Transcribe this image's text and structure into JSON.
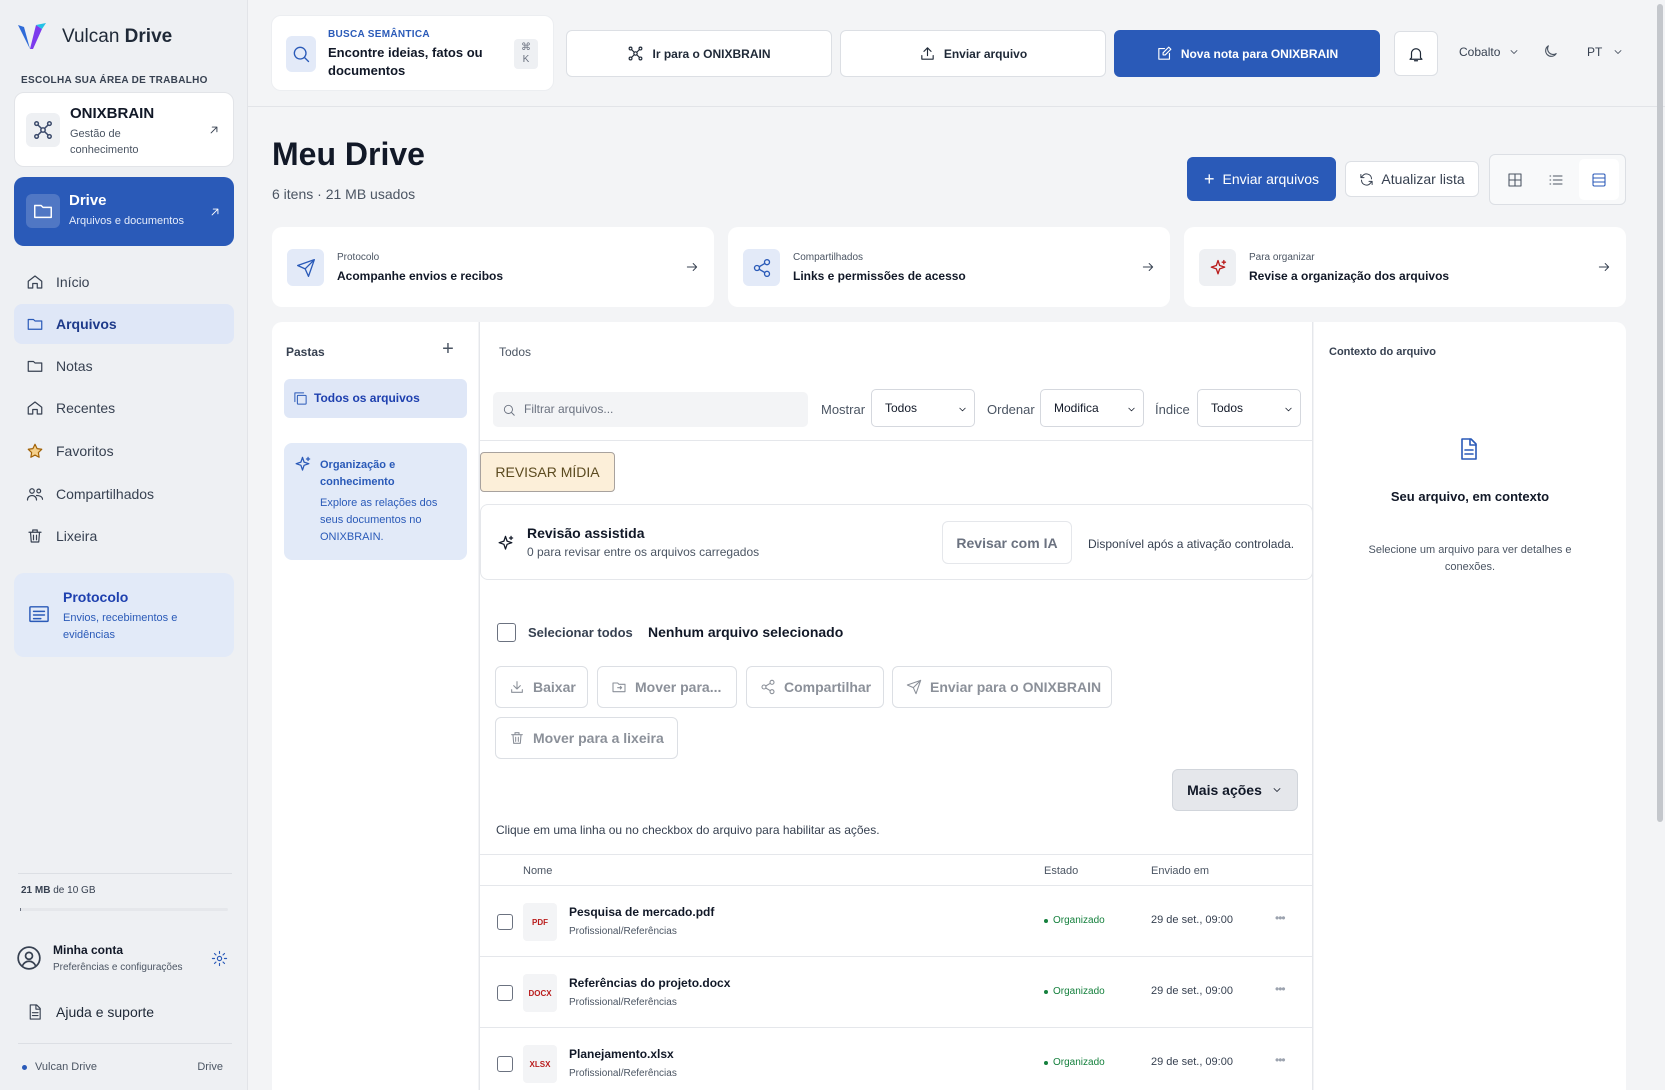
{
  "brand": {
    "name_light": "Vulcan",
    "name_bold": "Drive"
  },
  "sidebar": {
    "workspace_heading": "ESCOLHA SUA ÁREA DE TRABALHO",
    "onixbrain": {
      "title": "ONIXBRAIN",
      "subtitle": "Gestão de conhecimento"
    },
    "drive": {
      "title": "Drive",
      "subtitle": "Arquivos e documentos"
    },
    "nav": [
      "Início",
      "Arquivos",
      "Notas",
      "Recentes",
      "Favoritos",
      "Compartilhados",
      "Lixeira"
    ],
    "protocol": {
      "title": "Protocolo",
      "subtitle": "Envios, recebimentos e evidências"
    },
    "storage": {
      "used": "21 MB",
      "of_total": " de 10 GB",
      "fraction": 0.002
    },
    "account": {
      "title": "Minha conta",
      "subtitle": "Preferências e configurações"
    },
    "help": "Ajuda e suporte",
    "footer": {
      "left": "Vulcan Drive",
      "right": "Drive"
    }
  },
  "topbar": {
    "search": {
      "kicker": "BUSCA SEMÂNTICA",
      "text": "Encontre ideias, fatos ou documentos",
      "shortcut1": "⌘",
      "shortcut2": "K"
    },
    "goto_onixbrain": "Ir para o ONIXBRAIN",
    "upload": "Enviar arquivo",
    "new_note": "Nova nota para ONIXBRAIN",
    "theme": "Cobalto",
    "lang": "PT"
  },
  "page": {
    "title": "Meu Drive",
    "subtitle": "6 itens · 21 MB usados",
    "upload_files": "Enviar arquivos",
    "refresh": "Atualizar lista"
  },
  "quick_cards": [
    {
      "kicker": "Protocolo",
      "title": "Acompanhe envios e recibos"
    },
    {
      "kicker": "Compartilhados",
      "title": "Links e permissões de acesso"
    },
    {
      "kicker": "Para organizar",
      "title": "Revise a organização dos arquivos"
    }
  ],
  "folders": {
    "heading": "Pastas",
    "all_files": "Todos os arquivos",
    "org": {
      "title": "Organização e conhecimento",
      "body": "Explore as relações dos seus documentos no ONIXBRAIN."
    }
  },
  "files": {
    "tab": "Todos",
    "filter_placeholder": "Filtrar arquivos...",
    "show_label": "Mostrar",
    "show_value": "Todos",
    "order_label": "Ordenar",
    "order_value": "Modifica",
    "index_label": "Índice",
    "index_value": "Todos",
    "review_media": "REVISAR MÍDIA",
    "assisted": {
      "title": "Revisão assistida",
      "subtitle": "0 para revisar entre os arquivos carregados",
      "button": "Revisar com IA",
      "note": "Disponível após a ativação controlada."
    },
    "select_all": "Selecionar todos",
    "selection_status": "Nenhum arquivo selecionado",
    "actions": {
      "download": "Baixar",
      "move": "Mover para...",
      "share": "Compartilhar",
      "send": "Enviar para o ONIXBRAIN",
      "trash": "Mover para a lixeira",
      "more": "Mais ações"
    },
    "hint": "Clique em uma linha ou no checkbox do arquivo para habilitar as ações.",
    "columns": {
      "name": "Nome",
      "status": "Estado",
      "sent": "Enviado em"
    },
    "rows": [
      {
        "badge": "PDF",
        "name": "Pesquisa de mercado.pdf",
        "path": "Profissional/Referências",
        "status": "Organizado",
        "date": "29 de set., 09:00"
      },
      {
        "badge": "DOCX",
        "name": "Referências do projeto.docx",
        "path": "Profissional/Referências",
        "status": "Organizado",
        "date": "29 de set., 09:00"
      },
      {
        "badge": "XLSX",
        "name": "Planejamento.xlsx",
        "path": "Profissional/Referências",
        "status": "Organizado",
        "date": "29 de set., 09:00"
      }
    ]
  },
  "context": {
    "heading": "Contexto do arquivo",
    "title": "Seu arquivo, em contexto",
    "body": "Selecione um arquivo para ver detalhes e conexões."
  },
  "colors": {
    "primary": "#2a5ab8",
    "active_nav": "#dfe7f7",
    "status_green": "#16a34a",
    "badge_red": "#b91c1c"
  }
}
